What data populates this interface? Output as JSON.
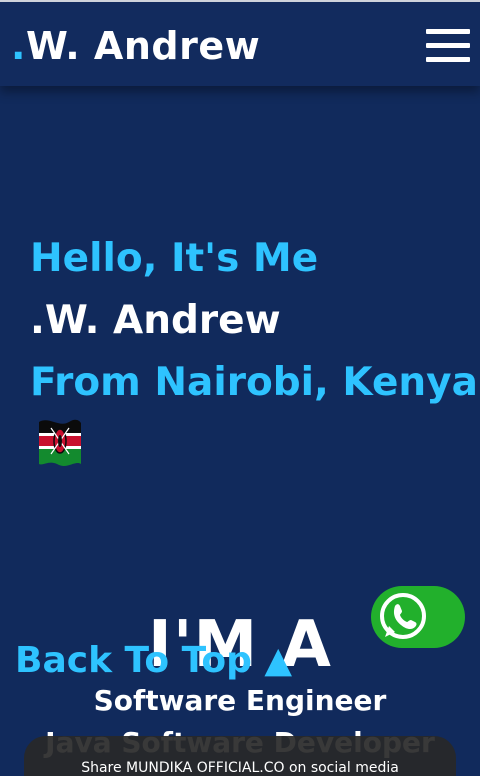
{
  "header": {
    "brand_dot": ".",
    "brand_name": "W. Andrew"
  },
  "menu": {
    "icon": "hamburger-menu-icon"
  },
  "hero": {
    "line1": "Hello, It's Me",
    "line2": ".W. Andrew",
    "line3": "From Nairobi, Kenya",
    "flag_icon": "kenya-flag-icon"
  },
  "intro": {
    "im_a": "I'M A",
    "role1": "Software Engineer",
    "role2": "Java Software Developer"
  },
  "back_to_top": {
    "label": "Back To Top ▲"
  },
  "whatsapp": {
    "icon": "whatsapp-icon",
    "color": "#22b02c"
  },
  "toast": {
    "text": "Share MUNDIKA OFFICIAL.CO on social media"
  },
  "colors": {
    "background": "#112a5c",
    "accent": "#2ec3ff",
    "text": "#ffffff"
  }
}
